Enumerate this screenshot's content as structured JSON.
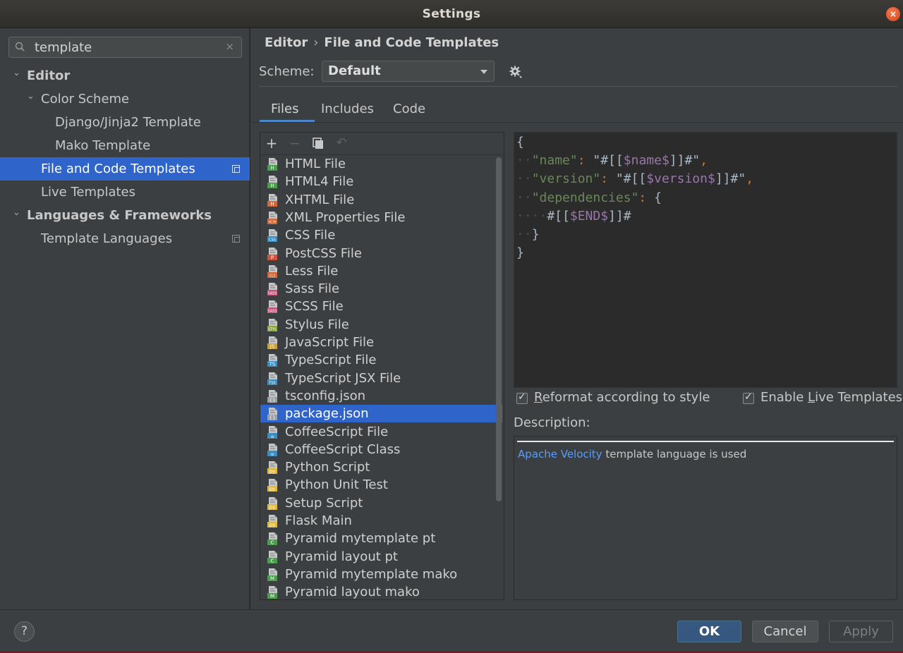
{
  "window": {
    "title": "Settings",
    "close_glyph": "×"
  },
  "search": {
    "value": "template",
    "clear_glyph": "×"
  },
  "tree": [
    {
      "label": "Editor",
      "chevron": "⌄",
      "bold": true
    },
    {
      "label": "Color Scheme",
      "chevron": "⌄",
      "bold": false
    },
    {
      "label": "Django/Jinja2 Template",
      "chevron": "",
      "bold": false
    },
    {
      "label": "Mako Template",
      "chevron": "",
      "bold": false
    },
    {
      "label": "File and Code Templates",
      "chevron": "",
      "bold": false,
      "selected": true,
      "copy_icon": true
    },
    {
      "label": "Live Templates",
      "chevron": "",
      "bold": false
    },
    {
      "label": "Languages & Frameworks",
      "chevron": "⌄",
      "bold": true
    },
    {
      "label": "Template Languages",
      "chevron": "",
      "bold": false,
      "copy_icon": true
    }
  ],
  "breadcrumb": {
    "parent": "Editor",
    "separator": "›",
    "current": "File and Code Templates"
  },
  "scheme": {
    "label": "Scheme:",
    "value": "Default"
  },
  "tabs": [
    {
      "label": "Files",
      "active": true
    },
    {
      "label": "Includes",
      "active": false
    },
    {
      "label": "Code",
      "active": false
    }
  ],
  "toolbar": {
    "add": "+",
    "remove": "−",
    "undo": "↶"
  },
  "files": [
    {
      "name": "HTML File",
      "badge": "H",
      "badge_color": "#4a9f4a"
    },
    {
      "name": "HTML4 File",
      "badge": "H",
      "badge_color": "#4a9f4a"
    },
    {
      "name": "XHTML File",
      "badge": "H",
      "badge_color": "#d2693a"
    },
    {
      "name": "XML Properties File",
      "badge": "<>",
      "badge_color": "#d2693a"
    },
    {
      "name": "CSS File",
      "badge": "CSS",
      "badge_color": "#3b8ec2"
    },
    {
      "name": "PostCSS File",
      "badge": "P",
      "badge_color": "#d2523a"
    },
    {
      "name": "Less File",
      "badge": "{L}",
      "badge_color": "#d2693a"
    },
    {
      "name": "Sass File",
      "badge": "SASS",
      "badge_color": "#c9527a"
    },
    {
      "name": "SCSS File",
      "badge": "SASS",
      "badge_color": "#c9527a"
    },
    {
      "name": "Stylus File",
      "badge": "STYL",
      "badge_color": "#8aa83a"
    },
    {
      "name": "JavaScript File",
      "badge": "JS",
      "badge_color": "#c9a23a"
    },
    {
      "name": "TypeScript File",
      "badge": "TS",
      "badge_color": "#3b8ec2"
    },
    {
      "name": "TypeScript JSX File",
      "badge": "TSX",
      "badge_color": "#3b8ec2"
    },
    {
      "name": "tsconfig.json",
      "badge": "{}",
      "badge_color": "#9aa0a3"
    },
    {
      "name": "package.json",
      "badge": "{}",
      "badge_color": "#9aa0a3",
      "selected": true
    },
    {
      "name": "CoffeeScript File",
      "badge": "☕",
      "badge_color": "#3b8ec2"
    },
    {
      "name": "CoffeeScript Class",
      "badge": "☕",
      "badge_color": "#3b8ec2"
    },
    {
      "name": "Python Script",
      "badge": "py",
      "badge_color": "#e2b93b"
    },
    {
      "name": "Python Unit Test",
      "badge": "py",
      "badge_color": "#e2b93b"
    },
    {
      "name": "Setup Script",
      "badge": "py",
      "badge_color": "#e2b93b"
    },
    {
      "name": "Flask Main",
      "badge": "py",
      "badge_color": "#e2b93b"
    },
    {
      "name": "Pyramid mytemplate pt",
      "badge": "C",
      "badge_color": "#4a9f4a"
    },
    {
      "name": "Pyramid layout pt",
      "badge": "C",
      "badge_color": "#4a9f4a"
    },
    {
      "name": "Pyramid mytemplate mako",
      "badge": "M",
      "badge_color": "#4a9f4a"
    },
    {
      "name": "Pyramid layout mako",
      "badge": "M",
      "badge_color": "#4a9f4a"
    }
  ],
  "editor": {
    "lines": [
      [
        {
          "t": "{",
          "c": "c-plain"
        }
      ],
      [
        {
          "t": "··",
          "c": "c-dot"
        },
        {
          "t": "\"name\"",
          "c": "c-str"
        },
        {
          "t": ": ",
          "c": "c-punct"
        },
        {
          "t": "\"#[[",
          "c": "c-plain"
        },
        {
          "t": "$name$",
          "c": "c-var"
        },
        {
          "t": "]]#\"",
          "c": "c-plain"
        },
        {
          "t": ",",
          "c": "c-punct"
        }
      ],
      [
        {
          "t": "··",
          "c": "c-dot"
        },
        {
          "t": "\"version\"",
          "c": "c-str"
        },
        {
          "t": ": ",
          "c": "c-punct"
        },
        {
          "t": "\"#[[",
          "c": "c-plain"
        },
        {
          "t": "$version$",
          "c": "c-var"
        },
        {
          "t": "]]#\"",
          "c": "c-plain"
        },
        {
          "t": ",",
          "c": "c-punct"
        }
      ],
      [
        {
          "t": "··",
          "c": "c-dot"
        },
        {
          "t": "\"dependencies\"",
          "c": "c-str"
        },
        {
          "t": ": ",
          "c": "c-punct"
        },
        {
          "t": "{",
          "c": "c-plain"
        }
      ],
      [
        {
          "t": "····",
          "c": "c-dot"
        },
        {
          "t": "#[[",
          "c": "c-plain"
        },
        {
          "t": "$END$",
          "c": "c-var"
        },
        {
          "t": "]]#",
          "c": "c-plain"
        }
      ],
      [
        {
          "t": "··",
          "c": "c-dot"
        },
        {
          "t": "}",
          "c": "c-plain"
        }
      ],
      [
        {
          "t": "}",
          "c": "c-plain"
        }
      ]
    ]
  },
  "options": {
    "reformat": {
      "prefix": "",
      "mnemonic": "R",
      "rest": "eformat according to style",
      "checked": true
    },
    "live_templates": {
      "prefix": "Enable ",
      "mnemonic": "L",
      "rest": "ive Templates",
      "checked": true
    }
  },
  "description": {
    "label": "Description:",
    "link": "Apache Velocity",
    "text": " template language is used"
  },
  "buttons": {
    "help": "?",
    "ok": "OK",
    "cancel": "Cancel",
    "apply": "Apply"
  }
}
